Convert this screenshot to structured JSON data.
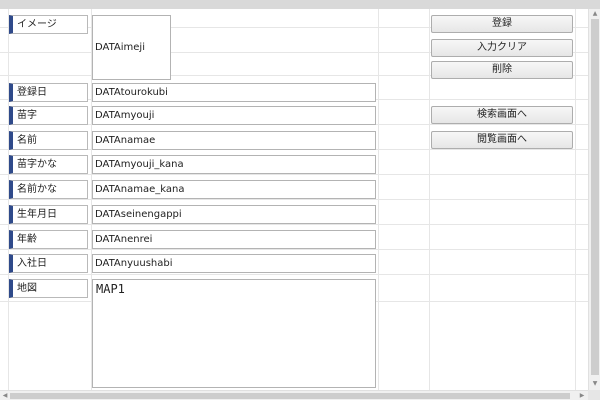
{
  "form": {
    "labels": {
      "imeji": "イメージ",
      "tourokubi": "登録日",
      "myouji": "苗字",
      "namae": "名前",
      "myouji_kana": "苗字かな",
      "namae_kana": "名前かな",
      "seinengappi": "生年月日",
      "nenrei": "年齢",
      "nyuushabi": "入社日",
      "chizu": "地図"
    },
    "values": {
      "imeji": "DATAimeji",
      "tourokubi": "DATAtourokubi",
      "myouji": "DATAmyouji",
      "namae": "DATAnamae",
      "myouji_kana": "DATAmyouji_kana",
      "namae_kana": "DATAnamae_kana",
      "seinengappi": "DATAseinengappi",
      "nenrei": "DATAnenrei",
      "nyuushabi": "DATAnyuushabi",
      "chizu": "MAP1"
    }
  },
  "buttons": {
    "register": "登録",
    "clear_input": "入力クリア",
    "delete": "削除",
    "to_search": "検索画面へ",
    "to_browse": "閲覧画面へ"
  },
  "colors": {
    "label_accent": "#2f4a8a",
    "background": "#ffffff"
  }
}
